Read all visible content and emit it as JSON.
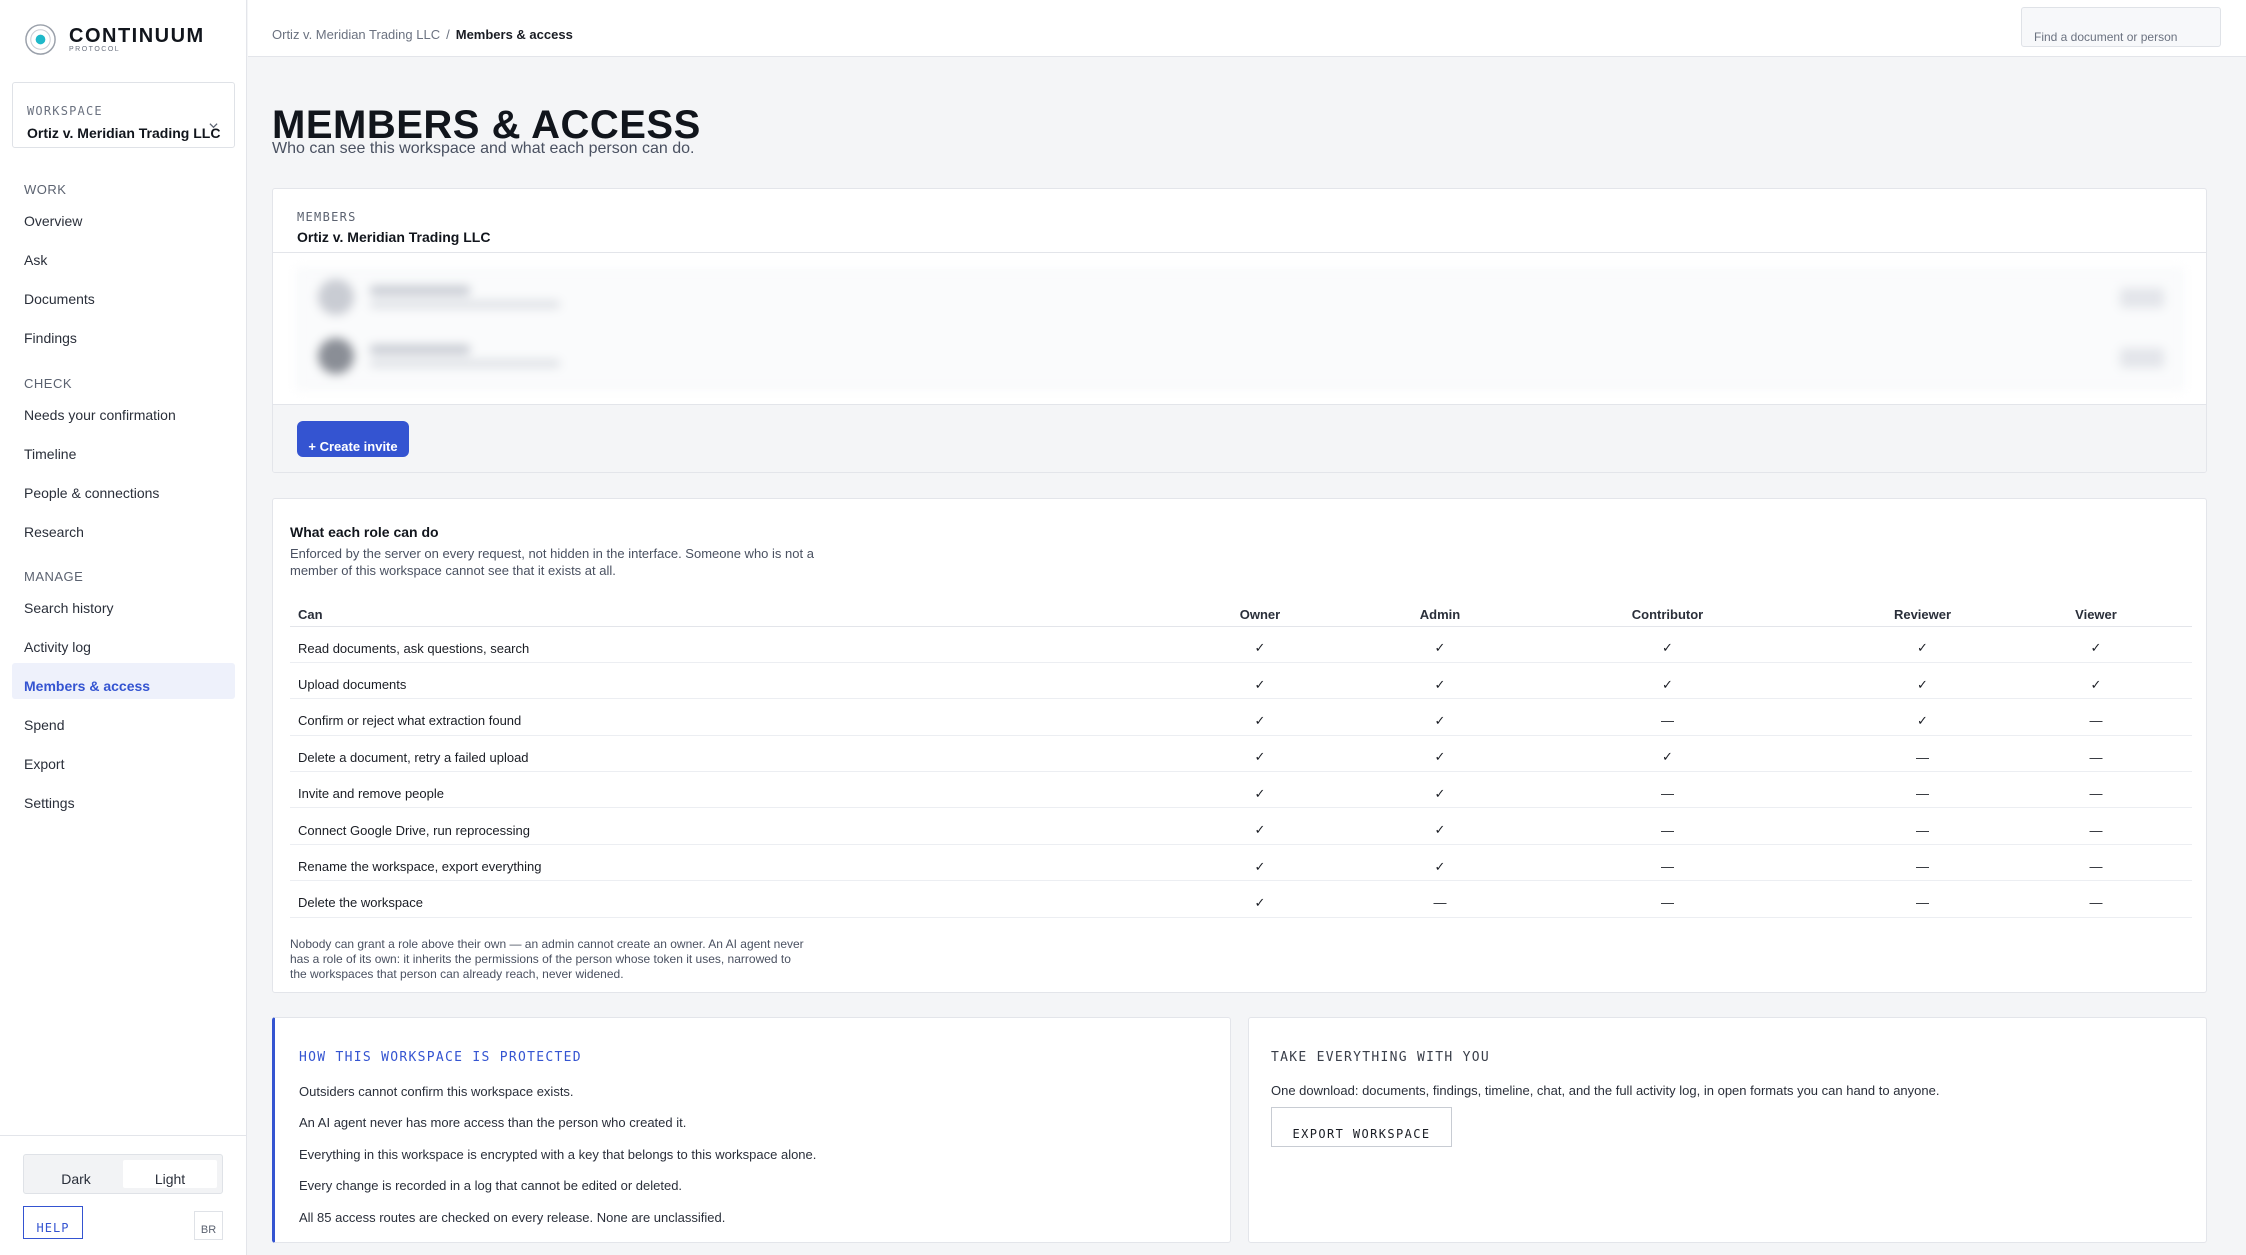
{
  "brand": {
    "name": "CONTINUUM",
    "sub": "PROTOCOL",
    "accent": "#3454d1"
  },
  "workspace": {
    "label": "WORKSPACE",
    "value": "Ortiz v. Meridian Trading LLC"
  },
  "nav": {
    "work_label": "WORK",
    "work": [
      "Overview",
      "Ask",
      "Documents",
      "Findings"
    ],
    "check_label": "CHECK",
    "check": [
      "Needs your confirmation",
      "Timeline",
      "People & connections",
      "Research"
    ],
    "manage_label": "MANAGE",
    "manage": [
      "Search history",
      "Activity log",
      "Members & access",
      "Spend",
      "Export",
      "Settings"
    ],
    "active": "Members & access"
  },
  "footer": {
    "dark": "Dark",
    "light": "Light",
    "help": "HELP",
    "badge": "BR"
  },
  "topbar": {
    "crumb_parent": "Ortiz v. Meridian Trading LLC",
    "crumb_sep": "/",
    "crumb_current": "Members & access",
    "search_placeholder": "Find a document or person"
  },
  "page": {
    "title": "MEMBERS & ACCESS",
    "subtitle": "Who can see this workspace and what each person can do."
  },
  "members": {
    "label": "MEMBERS",
    "workspace": "Ortiz v. Meridian Trading LLC",
    "invite_label": "+ Create invite"
  },
  "roles": {
    "title": "What each role can do",
    "description": "Enforced by the server on every request, not hidden in the interface. Someone who is not a member of this workspace cannot see that it exists at all.",
    "columns": [
      "Can",
      "Owner",
      "Admin",
      "Contributor",
      "Reviewer",
      "Viewer"
    ],
    "check_glyph": "✓",
    "dash_glyph": "—",
    "rows": [
      {
        "label": "Read documents, ask questions, search",
        "cells": [
          "✓",
          "✓",
          "✓",
          "✓",
          "✓"
        ]
      },
      {
        "label": "Upload documents",
        "cells": [
          "✓",
          "✓",
          "✓",
          "✓",
          "✓"
        ]
      },
      {
        "label": "Confirm or reject what extraction found",
        "cells": [
          "✓",
          "✓",
          "—",
          "✓",
          "—"
        ]
      },
      {
        "label": "Delete a document, retry a failed upload",
        "cells": [
          "✓",
          "✓",
          "✓",
          "—",
          "—"
        ]
      },
      {
        "label": "Invite and remove people",
        "cells": [
          "✓",
          "✓",
          "—",
          "—",
          "—"
        ]
      },
      {
        "label": "Connect Google Drive, run reprocessing",
        "cells": [
          "✓",
          "✓",
          "—",
          "—",
          "—"
        ]
      },
      {
        "label": "Rename the workspace, export everything",
        "cells": [
          "✓",
          "✓",
          "—",
          "—",
          "—"
        ]
      },
      {
        "label": "Delete the workspace",
        "cells": [
          "✓",
          "—",
          "—",
          "—",
          "—"
        ]
      }
    ],
    "note": "Nobody can grant a role above their own — an admin cannot create an owner. An AI agent never has a role of its own: it inherits the permissions of the person whose token it uses, narrowed to the workspaces that person can already reach, never widened."
  },
  "protection": {
    "title": "HOW THIS WORKSPACE IS PROTECTED",
    "items": [
      "Outsiders cannot confirm this workspace exists.",
      "An AI agent never has more access than the person who created it.",
      "Everything in this workspace is encrypted with a key that belongs to this workspace alone.",
      "Every change is recorded in a log that cannot be edited or deleted.",
      "All 85 access routes are checked on every release. None are unclassified."
    ]
  },
  "export": {
    "title": "TAKE EVERYTHING WITH YOU",
    "description": "One download: documents, findings, timeline, chat, and the full activity log, in open formats you can hand to anyone.",
    "button": "EXPORT WORKSPACE"
  }
}
